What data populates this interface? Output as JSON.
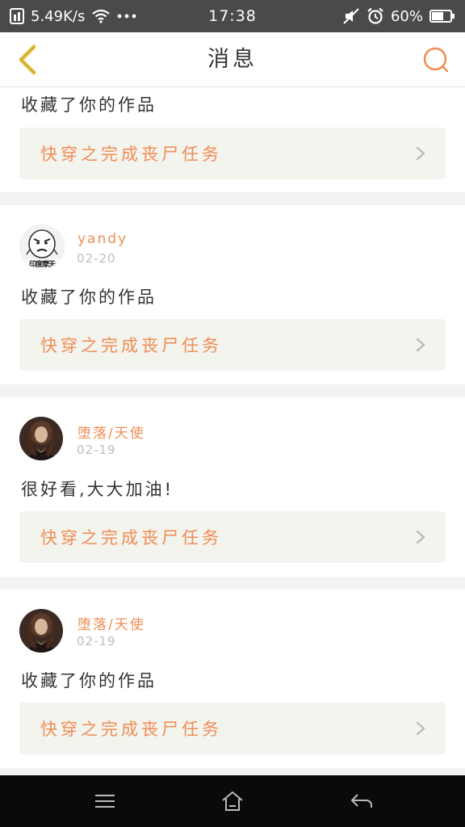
{
  "status_bar": {
    "speed": "5.49K/s",
    "time": "17:38",
    "battery": "60%"
  },
  "header": {
    "title": "消息"
  },
  "messages": [
    {
      "user": "",
      "date": "",
      "text": "收藏了你的作品",
      "work_title": "快穿之完成丧尸任务"
    },
    {
      "user": "yandy",
      "date": "02-20",
      "avatar_text": "印度摩天",
      "text": "收藏了你的作品",
      "work_title": "快穿之完成丧尸任务"
    },
    {
      "user": "堕落/天使",
      "date": "02-19",
      "text": "很好看,大大加油!",
      "work_title": "快穿之完成丧尸任务"
    },
    {
      "user": "堕落/天使",
      "date": "02-19",
      "text": "收藏了你的作品",
      "work_title": "快穿之完成丧尸任务"
    }
  ],
  "colors": {
    "accent": "#ef8d55",
    "back_arrow": "#e8c340",
    "card_bg": "#f4f4ef",
    "status_bar": "#4a4a4a"
  }
}
